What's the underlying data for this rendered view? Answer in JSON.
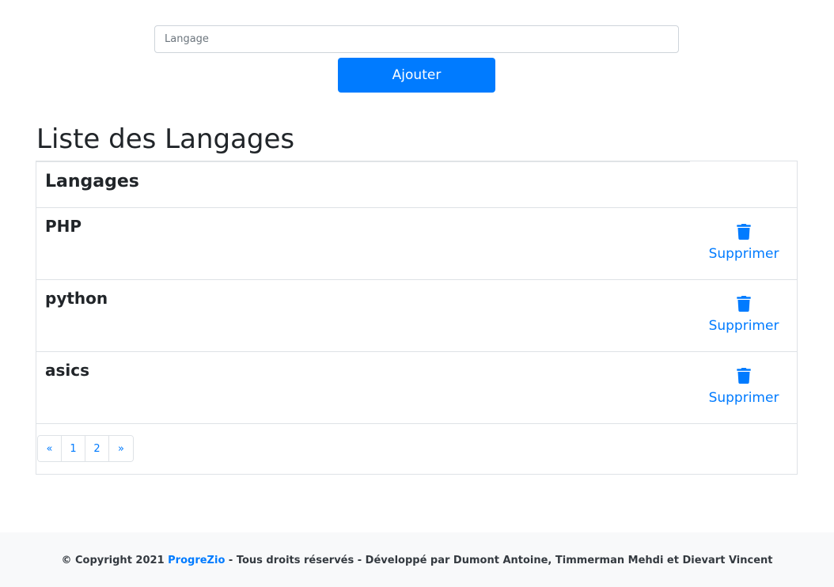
{
  "form": {
    "input_placeholder": "Langage",
    "input_value": "",
    "add_button_label": "Ajouter"
  },
  "page_title": "Liste des Langages",
  "list": {
    "header": "Langages",
    "rows": [
      {
        "name": "PHP",
        "action_label": "Supprimer",
        "action_icon": "trash-icon"
      },
      {
        "name": "python",
        "action_label": "Supprimer",
        "action_icon": "trash-icon"
      },
      {
        "name": "asics",
        "action_label": "Supprimer",
        "action_icon": "trash-icon"
      }
    ]
  },
  "pagination": {
    "prev": "«",
    "pages": [
      "1",
      "2"
    ],
    "next": "»"
  },
  "footer": {
    "prefix": "© Copyright 2021",
    "brand": "ProgreZio",
    "suffix": "- Tous droits réservés - Développé par Dumont Antoine, Timmerman Mehdi et Dievart Vincent"
  },
  "colors": {
    "accent": "#007bff",
    "text": "#212529",
    "border": "#dee2e6",
    "footer_bg": "#f8f9fa"
  }
}
